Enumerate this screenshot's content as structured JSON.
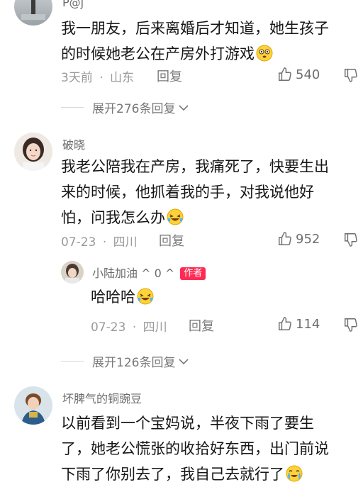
{
  "comments": [
    {
      "username": "P@j",
      "text_line1": "我一朋友，后来离婚后才知道，她生孩子",
      "text_line2": "的时候她老公在产房外打游戏",
      "date": "3天前",
      "location": "山东",
      "reply_label": "回复",
      "likes": "540",
      "expand_label": "展开276条回复",
      "emoji_icon": "flushed-face-icon"
    },
    {
      "username": "破晓",
      "text_line1": "我老公陪我在产房，我痛死了，快要生出",
      "text_line2": "来的时候，他抓着我的手，对我说他好",
      "text_line3": "怕，问我怎么办",
      "date": "07-23",
      "location": "四川",
      "reply_label": "回复",
      "likes": "952",
      "emoji_icon": "laughing-tears-icon",
      "reply": {
        "username": "小陆加油 ^ 0 ^",
        "author_tag": "作者",
        "text": "哈哈哈",
        "date": "07-23",
        "location": "四川",
        "reply_label": "回复",
        "likes": "114",
        "emoji_icon": "laughing-tears-icon"
      },
      "expand_label": "展开126条回复"
    },
    {
      "username": "坏脾气的铜豌豆",
      "text_line1": "以前看到一个宝妈说，半夜下雨了要生",
      "text_line2": "了，她老公慌张的收拾好东西，出门前说",
      "text_line3": "下雨了你别去了，我自己去就行了",
      "emoji_icon": "crying-laughing-icon"
    }
  ],
  "separator": "·",
  "colors": {
    "author_tag": "#fe2c55",
    "meta": "#9a9a9a",
    "text": "#161616"
  }
}
